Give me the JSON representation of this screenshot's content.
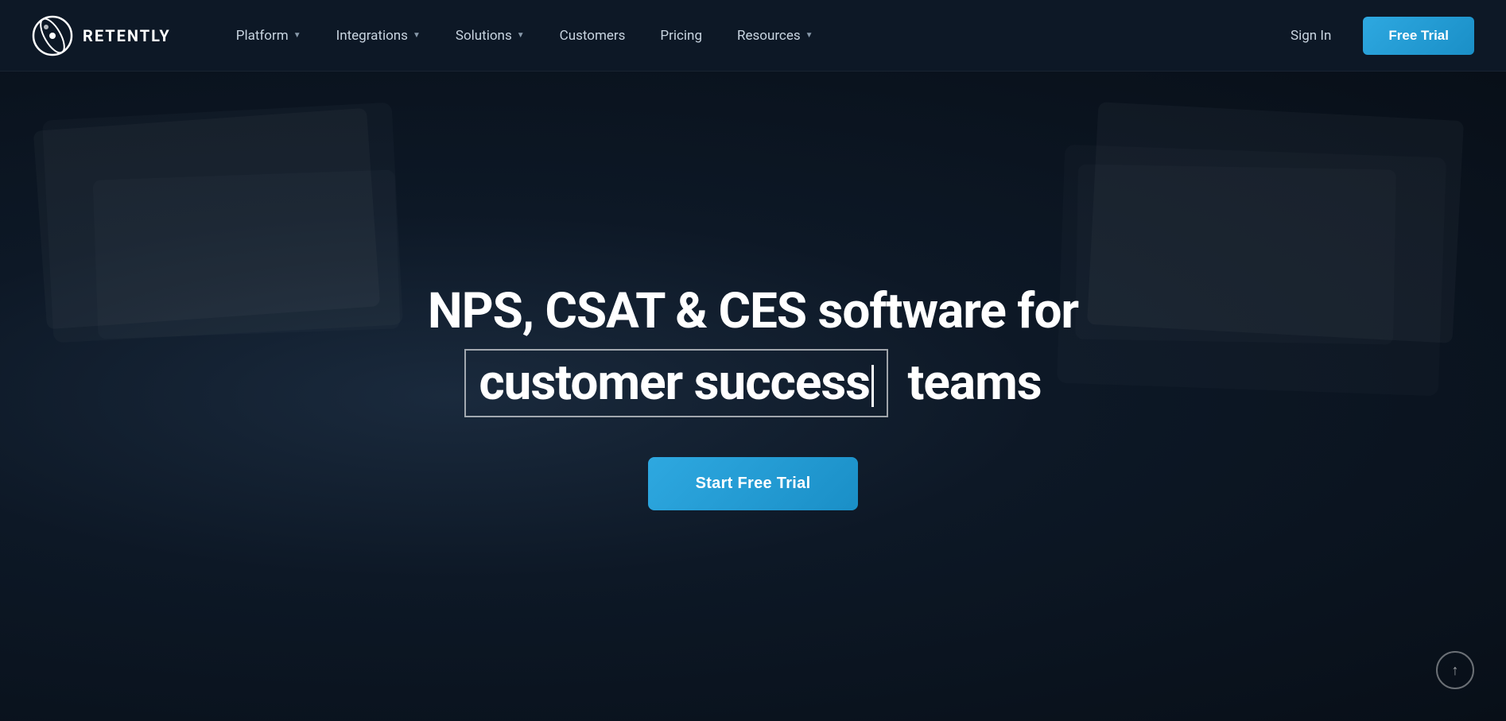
{
  "brand": {
    "name": "RETENTLY",
    "logo_alt": "Retently logo"
  },
  "navbar": {
    "links": [
      {
        "id": "platform",
        "label": "Platform",
        "has_dropdown": true
      },
      {
        "id": "integrations",
        "label": "Integrations",
        "has_dropdown": true
      },
      {
        "id": "solutions",
        "label": "Solutions",
        "has_dropdown": true
      },
      {
        "id": "customers",
        "label": "Customers",
        "has_dropdown": false
      },
      {
        "id": "pricing",
        "label": "Pricing",
        "has_dropdown": false
      },
      {
        "id": "resources",
        "label": "Resources",
        "has_dropdown": true
      }
    ],
    "sign_in_label": "Sign In",
    "free_trial_label": "Free Trial"
  },
  "hero": {
    "title_line1": "NPS, CSAT & CES software for",
    "title_highlighted": "customer success",
    "title_line2_after": "teams",
    "cta_label": "Start Free Trial"
  },
  "scroll_top_icon": "↑"
}
